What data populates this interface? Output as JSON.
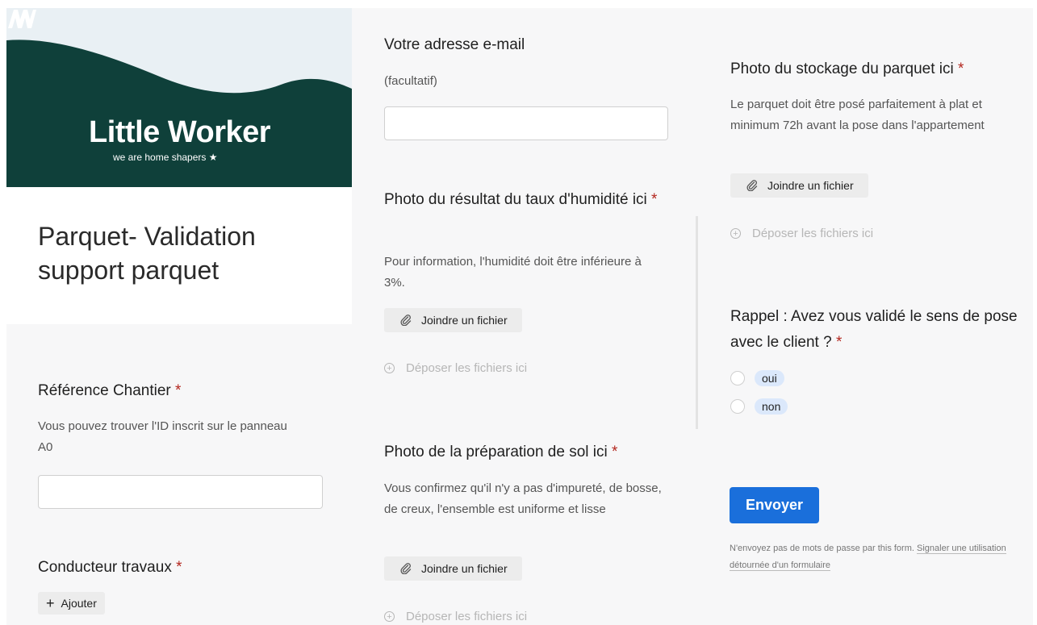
{
  "header": {
    "logo_text": "Little Worker",
    "logo_tagline": "we are home shapers ★",
    "form_title": "Parquet- Validation support parquet",
    "brand_color": "#0f403a"
  },
  "fields": {
    "reference": {
      "title": "Référence Chantier",
      "required_mark": "*",
      "description": "Vous pouvez trouver l'ID inscrit sur le panneau A0",
      "value": ""
    },
    "conducteur": {
      "title": "Conducteur travaux",
      "required_mark": "*",
      "add_label": "Ajouter"
    },
    "email": {
      "title": "Votre adresse e-mail",
      "optional_note": "(facultatif)",
      "value": ""
    },
    "humidity_photo": {
      "title": "Photo du résultat du taux d'humidité ici",
      "required_mark": "*",
      "description": "Pour information, l'humidité doit être inférieure à 3%.",
      "attach_label": "Joindre un fichier",
      "drop_label": "Déposer les fichiers ici"
    },
    "floor_prep_photo": {
      "title": "Photo de la préparation de sol ici",
      "required_mark": "*",
      "description": "Vous confirmez qu'il n'y a pas d'impureté, de bosse, de creux, l'ensemble est uniforme et lisse",
      "attach_label": "Joindre un fichier",
      "drop_label": "Déposer les fichiers ici"
    },
    "storage_photo": {
      "title": "Photo du stockage du parquet ici",
      "required_mark": "*",
      "description": "Le parquet doit être posé parfaitement à plat et minimum 72h avant la pose dans l'appartement",
      "attach_label": "Joindre un fichier",
      "drop_label": "Déposer les fichiers ici"
    },
    "reminder": {
      "title": "Rappel : Avez vous validé le sens de pose avec le client ?",
      "required_mark": "*",
      "options": [
        "oui",
        "non"
      ]
    }
  },
  "submit": {
    "label": "Envoyer",
    "color": "#1a6fdb"
  },
  "footer": {
    "note": "N'envoyez pas de mots de passe par this form.",
    "report_link": "Signaler une utilisation détournée d'un formulaire"
  }
}
